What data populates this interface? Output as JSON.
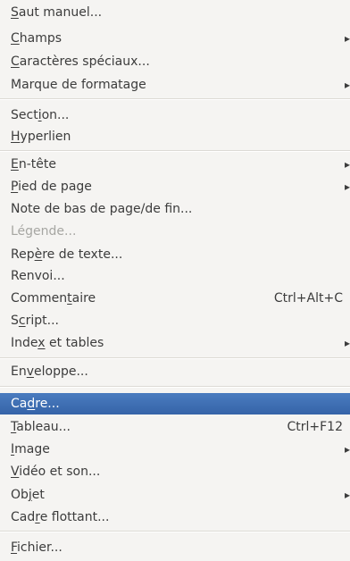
{
  "menu": {
    "items": [
      {
        "label": "Saut manuel...",
        "mnemonic": "S"
      },
      {
        "label": "Champs",
        "mnemonic": "C",
        "submenu": true
      },
      {
        "label": "Caractères spéciaux...",
        "mnemonic": "C"
      },
      {
        "label": "Marque de formatage",
        "submenu": true
      },
      {
        "label": "Section...",
        "mnemonic": "i"
      },
      {
        "label": "Hyperlien",
        "mnemonic": "H"
      },
      {
        "label": "En-tête",
        "mnemonic": "E",
        "submenu": true
      },
      {
        "label": "Pied de page",
        "mnemonic": "P",
        "submenu": true
      },
      {
        "label": "Note de bas de page/de fin..."
      },
      {
        "label": "Légende...",
        "disabled": true
      },
      {
        "label": "Repère de texte...",
        "mnemonic": "è"
      },
      {
        "label": "Renvoi..."
      },
      {
        "label": "Commentaire",
        "mnemonic": "t",
        "shortcut": "Ctrl+Alt+C"
      },
      {
        "label": "Script...",
        "mnemonic": "c"
      },
      {
        "label": "Index et tables",
        "mnemonic": "x",
        "submenu": true
      },
      {
        "label": "Enveloppe...",
        "mnemonic": "v"
      },
      {
        "label": "Cadre...",
        "mnemonic": "d",
        "selected": true
      },
      {
        "label": "Tableau...",
        "mnemonic": "T",
        "shortcut": "Ctrl+F12"
      },
      {
        "label": "Image",
        "mnemonic": "I",
        "submenu": true
      },
      {
        "label": "Vidéo et son...",
        "mnemonic": "V"
      },
      {
        "label": "Objet",
        "mnemonic": "j",
        "submenu": true
      },
      {
        "label": "Cadre flottant...",
        "mnemonic": "r"
      },
      {
        "label": "Fichier...",
        "mnemonic": "F"
      }
    ],
    "submenu_glyph": "▸"
  }
}
